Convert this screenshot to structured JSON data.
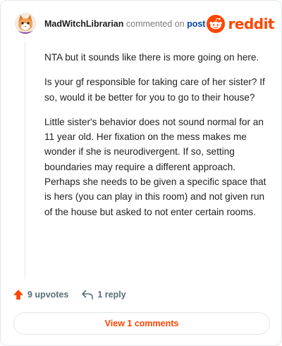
{
  "comment": {
    "author": "MadWitchLibrarian",
    "action_text": "commented on",
    "link_text": "post",
    "paragraphs": [
      "NTA but it sounds like there is more going on here.",
      "Is your gf responsible for taking care of her sister? If so, would it be better for you to go to their house?",
      "Little sister's behavior does not sound normal for an 11 year old. Her fixation on the mess makes me wonder if she is neurodivergent. If so, setting boundaries may require a different approach. Perhaps she needs to be given a specific space that is hers (you can play in this room) and not given run of the house but asked to not enter certain rooms."
    ]
  },
  "brand": {
    "name": "reddit",
    "icon": "reddit-snoo-icon",
    "color": "#ff4500"
  },
  "actions": {
    "upvotes_label": "9 upvotes",
    "upvote_icon": "upvote-arrow-icon",
    "reply_label": "1 reply",
    "reply_icon": "reply-arrow-icon"
  },
  "view_comments_label": "View 1 comments",
  "colors": {
    "accent": "#ff4500",
    "link": "#0045ac",
    "muted": "#576f76"
  }
}
